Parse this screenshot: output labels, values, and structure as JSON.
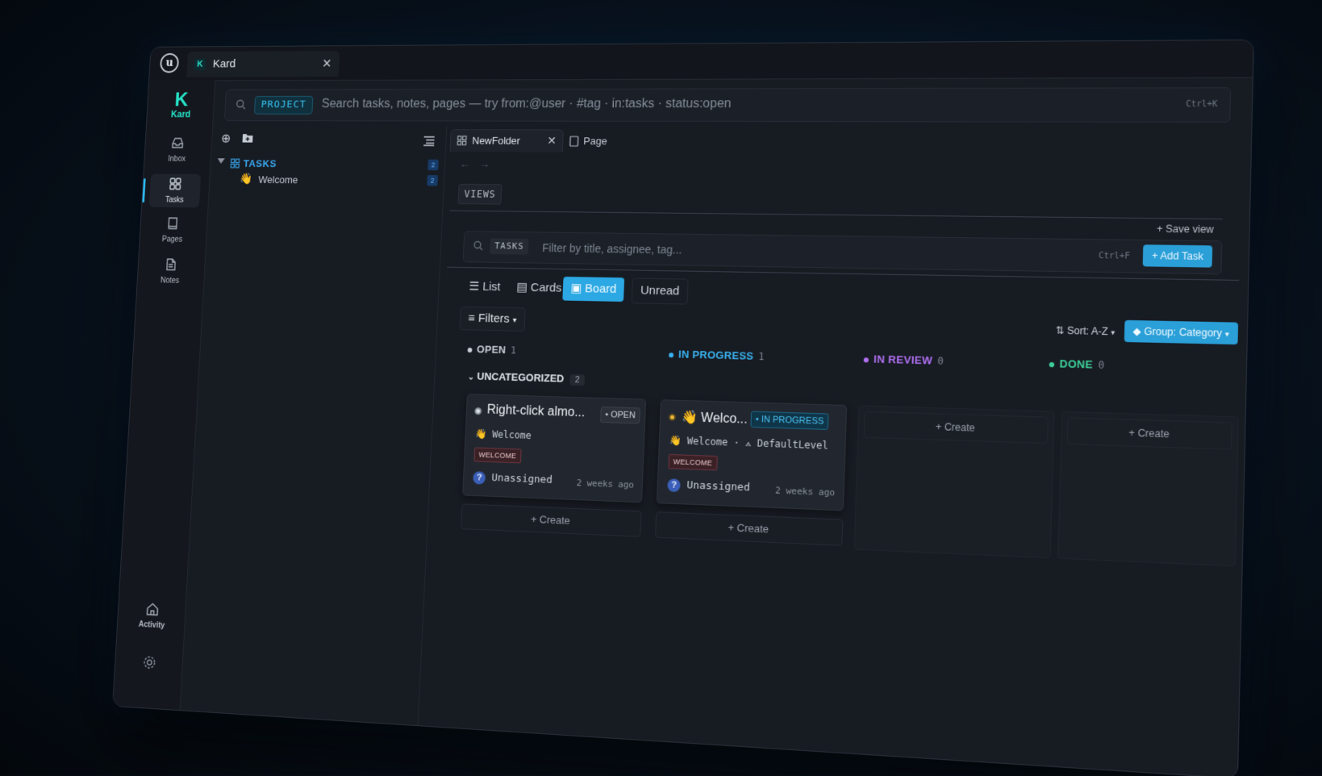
{
  "app": {
    "title": "Kard",
    "brand_letter": "K",
    "brand_name": "Kard",
    "engine_logo": "u"
  },
  "rail": {
    "items": [
      {
        "label": "Inbox",
        "icon": "inbox-icon"
      },
      {
        "label": "Tasks",
        "icon": "tasks-grid-icon",
        "active": true
      },
      {
        "label": "Pages",
        "icon": "book-icon"
      },
      {
        "label": "Notes",
        "icon": "notes-icon"
      }
    ],
    "activity_label": "Activity"
  },
  "search": {
    "scope": "PROJECT",
    "placeholder": "Search tasks, notes, pages — try from:@user · #tag · in:tasks · status:open",
    "shortcut": "Ctrl+K"
  },
  "explorer": {
    "folder": {
      "label": "TASKS",
      "count": "2"
    },
    "items": [
      {
        "emoji": "👋",
        "label": "Welcome",
        "count": "2"
      }
    ]
  },
  "tabs": [
    {
      "label": "NewFolder",
      "active": true
    },
    {
      "label": "Page"
    }
  ],
  "nav": {
    "back": "←",
    "forward": "→"
  },
  "views": {
    "label": "VIEWS",
    "save_view": "+ Save view"
  },
  "filter": {
    "scope": "TASKS",
    "placeholder": "Filter by title, assignee, tag...",
    "shortcut": "Ctrl+F",
    "add_task": "+ Add Task"
  },
  "view_modes": {
    "list": "List",
    "cards": "Cards",
    "board": "Board",
    "unread": "Unread"
  },
  "toolbar": {
    "filters": "Filters",
    "sort": "Sort: A-Z",
    "group": "Group: Category"
  },
  "columns": [
    {
      "label": "OPEN",
      "count": "1",
      "color": "#c9ced6"
    },
    {
      "label": "IN PROGRESS",
      "count": "1",
      "color": "#3ab4f2"
    },
    {
      "label": "IN REVIEW",
      "count": "0",
      "color": "#b070f2"
    },
    {
      "label": "DONE",
      "count": "0",
      "color": "#3ed19a"
    }
  ],
  "group": {
    "label": "UNCATEGORIZED",
    "count": "2"
  },
  "cards": [
    {
      "title": "Right-click almo...",
      "status": "OPEN",
      "meta": "👋 Welcome",
      "tag": "WELCOME",
      "assignee": "Unassigned",
      "time": "2 weeks ago"
    },
    {
      "title": "👋 Welco...",
      "status": "IN PROGRESS",
      "meta": "👋 Welcome · ⟑ DefaultLevel",
      "tag": "WELCOME",
      "assignee": "Unassigned",
      "time": "2 weeks ago"
    }
  ],
  "create_label": "+ Create",
  "colors": {
    "accent": "#2ca8e4",
    "brand": "#27e3c9",
    "background": "#171b22"
  }
}
